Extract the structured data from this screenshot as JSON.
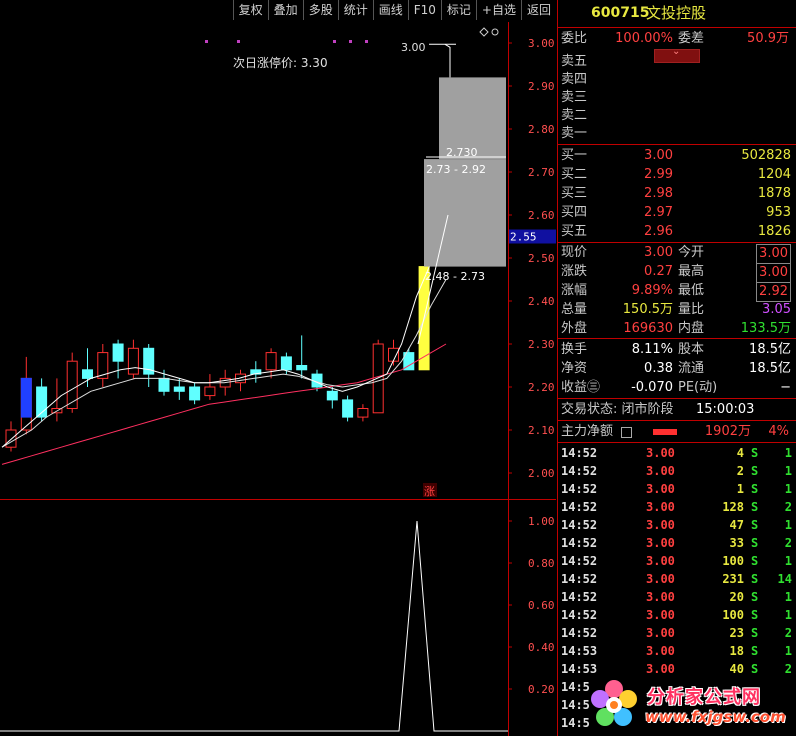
{
  "toolbar": {
    "buttons": [
      "复权",
      "叠加",
      "多股",
      "统计",
      "画线",
      "F10",
      "标记",
      "+自选",
      "返回"
    ]
  },
  "chart": {
    "limit_up_label": "次日涨停价: 3.30",
    "peak_label": "3.00",
    "box_upper_value": "2.730",
    "box_upper_range": "2.73 - 2.92",
    "box_lower_range": "2.48 - 2.73",
    "zhang_badge": "涨",
    "current_price_tag": "2.55",
    "price_ticks": [
      "3.00",
      "2.90",
      "2.80",
      "2.70",
      "2.60",
      "2.50",
      "2.40",
      "2.30",
      "2.20",
      "2.10",
      "2.00"
    ],
    "sub_ticks": [
      "1.00",
      "0.80",
      "0.60",
      "0.40",
      "0.20"
    ],
    "colors": {
      "up": "#ff3030",
      "down": "#60ffff",
      "ma_white": "#ffffff",
      "ma_pink": "#ff3060",
      "box": "#a0a0a0",
      "yellow_bar": "#ffff40"
    }
  },
  "chart_data": {
    "type": "candlestick",
    "candles": [
      {
        "o": 2.06,
        "c": 2.1,
        "h": 2.12,
        "l": 2.05
      },
      {
        "o": 2.1,
        "c": 2.22,
        "h": 2.27,
        "l": 2.09
      },
      {
        "o": 2.2,
        "c": 2.13,
        "h": 2.22,
        "l": 2.12
      },
      {
        "o": 2.14,
        "c": 2.15,
        "h": 2.22,
        "l": 2.12
      },
      {
        "o": 2.15,
        "c": 2.26,
        "h": 2.28,
        "l": 2.14
      },
      {
        "o": 2.24,
        "c": 2.22,
        "h": 2.29,
        "l": 2.2
      },
      {
        "o": 2.22,
        "c": 2.28,
        "h": 2.3,
        "l": 2.2
      },
      {
        "o": 2.3,
        "c": 2.26,
        "h": 2.31,
        "l": 2.22
      },
      {
        "o": 2.23,
        "c": 2.29,
        "h": 2.31,
        "l": 2.22
      },
      {
        "o": 2.29,
        "c": 2.23,
        "h": 2.3,
        "l": 2.2
      },
      {
        "o": 2.22,
        "c": 2.19,
        "h": 2.24,
        "l": 2.18
      },
      {
        "o": 2.2,
        "c": 2.19,
        "h": 2.22,
        "l": 2.17
      },
      {
        "o": 2.2,
        "c": 2.17,
        "h": 2.21,
        "l": 2.16
      },
      {
        "o": 2.18,
        "c": 2.2,
        "h": 2.23,
        "l": 2.17
      },
      {
        "o": 2.2,
        "c": 2.22,
        "h": 2.24,
        "l": 2.18
      },
      {
        "o": 2.21,
        "c": 2.23,
        "h": 2.24,
        "l": 2.19
      },
      {
        "o": 2.24,
        "c": 2.23,
        "h": 2.26,
        "l": 2.21
      },
      {
        "o": 2.24,
        "c": 2.28,
        "h": 2.29,
        "l": 2.22
      },
      {
        "o": 2.27,
        "c": 2.24,
        "h": 2.28,
        "l": 2.23
      },
      {
        "o": 2.25,
        "c": 2.24,
        "h": 2.32,
        "l": 2.22
      },
      {
        "o": 2.23,
        "c": 2.2,
        "h": 2.24,
        "l": 2.19
      },
      {
        "o": 2.19,
        "c": 2.17,
        "h": 2.2,
        "l": 2.15
      },
      {
        "o": 2.17,
        "c": 2.13,
        "h": 2.18,
        "l": 2.12
      },
      {
        "o": 2.13,
        "c": 2.15,
        "h": 2.16,
        "l": 2.12
      },
      {
        "o": 2.14,
        "c": 2.3,
        "h": 2.31,
        "l": 2.14
      },
      {
        "o": 2.26,
        "c": 2.29,
        "h": 2.31,
        "l": 2.25
      },
      {
        "o": 2.28,
        "c": 2.24,
        "h": 2.29,
        "l": 2.24
      },
      {
        "o": 2.24,
        "c": 2.48,
        "h": 2.48,
        "l": 2.24
      }
    ],
    "ma5": [
      2.06,
      2.09,
      2.12,
      2.15,
      2.18,
      2.2,
      2.22,
      2.23,
      2.24,
      2.245,
      2.24,
      2.23,
      2.22,
      2.21,
      2.21,
      2.215,
      2.22,
      2.23,
      2.235,
      2.24,
      2.23,
      2.215,
      2.2,
      2.19,
      2.2,
      2.215,
      2.23,
      2.3,
      2.41,
      2.49,
      2.55
    ],
    "ma10": [
      2.06,
      2.08,
      2.1,
      2.13,
      2.15,
      2.17,
      2.19,
      2.2,
      2.21,
      2.22,
      2.22,
      2.22,
      2.215,
      2.21,
      2.21,
      2.21,
      2.215,
      2.22,
      2.225,
      2.23,
      2.225,
      2.215,
      2.205,
      2.2,
      2.205,
      2.21,
      2.22,
      2.26,
      2.32,
      2.39,
      2.45
    ],
    "ma_long": [
      2.02,
      2.03,
      2.04,
      2.05,
      2.06,
      2.07,
      2.08,
      2.09,
      2.1,
      2.11,
      2.12,
      2.13,
      2.14,
      2.15,
      2.16,
      2.165,
      2.17,
      2.175,
      2.18,
      2.185,
      2.19,
      2.195,
      2.2,
      2.205,
      2.21,
      2.22,
      2.23,
      2.24,
      2.26,
      2.28,
      2.3
    ],
    "indicator": {
      "type": "line",
      "peak_value": 1.0,
      "peak_at": 0.82
    }
  },
  "panel": {
    "code": "600715",
    "name": "文投控股",
    "weibi_label": "委比",
    "weibi_value": "100.00%",
    "weicha_label": "委差",
    "weicha_value": "50.9万",
    "sell": [
      {
        "label": "卖五",
        "price": "",
        "vol": ""
      },
      {
        "label": "卖四",
        "price": "",
        "vol": ""
      },
      {
        "label": "卖三",
        "price": "",
        "vol": ""
      },
      {
        "label": "卖二",
        "price": "",
        "vol": ""
      },
      {
        "label": "卖一",
        "price": "",
        "vol": ""
      }
    ],
    "buy": [
      {
        "label": "买一",
        "price": "3.00",
        "vol": "502828"
      },
      {
        "label": "买二",
        "price": "2.99",
        "vol": "1204"
      },
      {
        "label": "买三",
        "price": "2.98",
        "vol": "1878"
      },
      {
        "label": "买四",
        "price": "2.97",
        "vol": "953"
      },
      {
        "label": "买五",
        "price": "2.96",
        "vol": "1826"
      }
    ],
    "stats": [
      {
        "l1": "现价",
        "v1": "3.00",
        "l2": "今开",
        "v2": "3.00",
        "c1": "red",
        "c2": "red"
      },
      {
        "l1": "涨跌",
        "v1": "0.27",
        "l2": "最高",
        "v2": "3.00",
        "c1": "red",
        "c2": "red"
      },
      {
        "l1": "涨幅",
        "v1": "9.89%",
        "l2": "最低",
        "v2": "2.92",
        "c1": "red",
        "c2": "red"
      },
      {
        "l1": "总量",
        "v1": "150.5万",
        "l2": "量比",
        "v2": "3.05",
        "c1": "yellow",
        "c2": "purple"
      },
      {
        "l1": "外盘",
        "v1": "169630",
        "l2": "内盘",
        "v2": "133.5万",
        "c1": "red",
        "c2": "green"
      }
    ],
    "stats2": [
      {
        "l1": "换手",
        "v1": "8.11%",
        "l2": "股本",
        "v2": "18.5亿"
      },
      {
        "l1": "净资",
        "v1": "0.38",
        "l2": "流通",
        "v2": "18.5亿"
      },
      {
        "l1": "收益㊂",
        "v1": "-0.070",
        "l2": "PE(动)",
        "v2": "−"
      }
    ],
    "status_label": "交易状态: 闭市阶段",
    "status_time": "15:00:03",
    "fund_label": "主力净额",
    "fund_value": "1902万",
    "fund_pct": "4%",
    "trades": [
      {
        "t": "14:52",
        "p": "3.00",
        "v": "4",
        "d": "S",
        "n": "1"
      },
      {
        "t": "14:52",
        "p": "3.00",
        "v": "2",
        "d": "S",
        "n": "1"
      },
      {
        "t": "14:52",
        "p": "3.00",
        "v": "1",
        "d": "S",
        "n": "1"
      },
      {
        "t": "14:52",
        "p": "3.00",
        "v": "128",
        "d": "S",
        "n": "2"
      },
      {
        "t": "14:52",
        "p": "3.00",
        "v": "47",
        "d": "S",
        "n": "1"
      },
      {
        "t": "14:52",
        "p": "3.00",
        "v": "33",
        "d": "S",
        "n": "2"
      },
      {
        "t": "14:52",
        "p": "3.00",
        "v": "100",
        "d": "S",
        "n": "1"
      },
      {
        "t": "14:52",
        "p": "3.00",
        "v": "231",
        "d": "S",
        "n": "14"
      },
      {
        "t": "14:52",
        "p": "3.00",
        "v": "20",
        "d": "S",
        "n": "1"
      },
      {
        "t": "14:52",
        "p": "3.00",
        "v": "100",
        "d": "S",
        "n": "1"
      },
      {
        "t": "14:52",
        "p": "3.00",
        "v": "23",
        "d": "S",
        "n": "2"
      },
      {
        "t": "14:53",
        "p": "3.00",
        "v": "18",
        "d": "S",
        "n": "1"
      },
      {
        "t": "14:53",
        "p": "3.00",
        "v": "40",
        "d": "S",
        "n": "2"
      },
      {
        "t": "14:5",
        "p": "",
        "v": "",
        "d": "",
        "n": ""
      },
      {
        "t": "14:5",
        "p": "",
        "v": "",
        "d": "",
        "n": ""
      },
      {
        "t": "14:5",
        "p": "",
        "v": "",
        "d": "",
        "n": ""
      }
    ]
  },
  "watermark": {
    "text_cn": "分析家公式网",
    "text_url": "www.fxjgsw.com"
  }
}
